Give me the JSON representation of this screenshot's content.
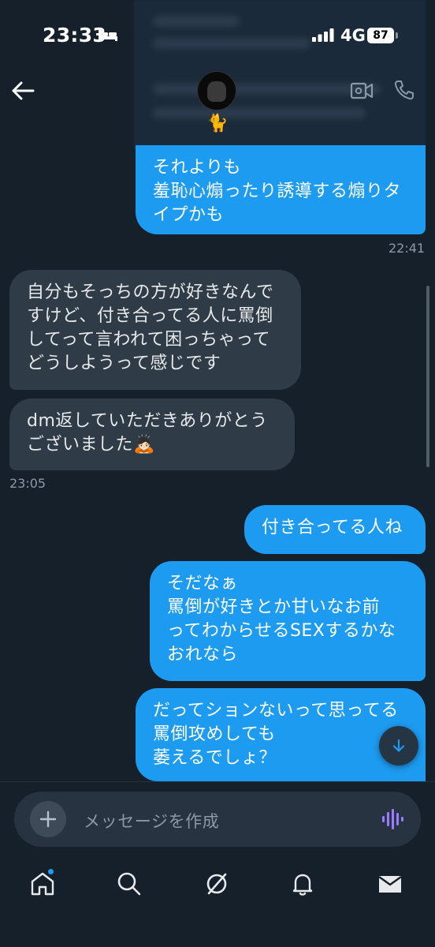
{
  "status_bar": {
    "time": "23:33",
    "network": "4G",
    "battery": "87"
  },
  "header": {
    "back_icon": "back-arrow-icon",
    "avatar_emoji": "🐈",
    "call_icons": [
      "video-call-icon",
      "phone-icon"
    ]
  },
  "messages": [
    {
      "id": "m1",
      "direction": "out",
      "text": "それよりも\n羞恥心煽ったり誘導する煽りタ\nイプかも"
    },
    {
      "id": "t1",
      "timestamp": "22:41"
    },
    {
      "id": "m2",
      "direction": "in",
      "text": "自分もそっちの方が好きなんで\nすけど、付き合ってる人に罵倒\nしてって言われて困っちゃって\nどうしようって感じです"
    },
    {
      "id": "m3",
      "direction": "in",
      "text": "dm返していただきありがとう\nございました🙇🏻"
    },
    {
      "id": "t2",
      "timestamp": "23:05"
    },
    {
      "id": "m4",
      "direction": "out",
      "text": "付き合ってる人ね"
    },
    {
      "id": "m5",
      "direction": "out",
      "text": "そだなぁ\n罵倒が好きとか甘いなお前\nってわからせるSEXするかな\nおれなら"
    },
    {
      "id": "m6",
      "direction": "out",
      "text": "だってションないって思ってる\n罵倒攻めしても\n萎えるでしょ？"
    }
  ],
  "composer": {
    "placeholder": "メッセージを作成"
  },
  "tabs": [
    "home-icon",
    "search-icon",
    "grok-icon",
    "notifications-icon",
    "messages-icon"
  ],
  "colors": {
    "background": "#15202b",
    "outgoing_bubble": "#1d9bf0",
    "incoming_bubble": "#2f3b47",
    "voice_accent": "#9b7bff"
  }
}
